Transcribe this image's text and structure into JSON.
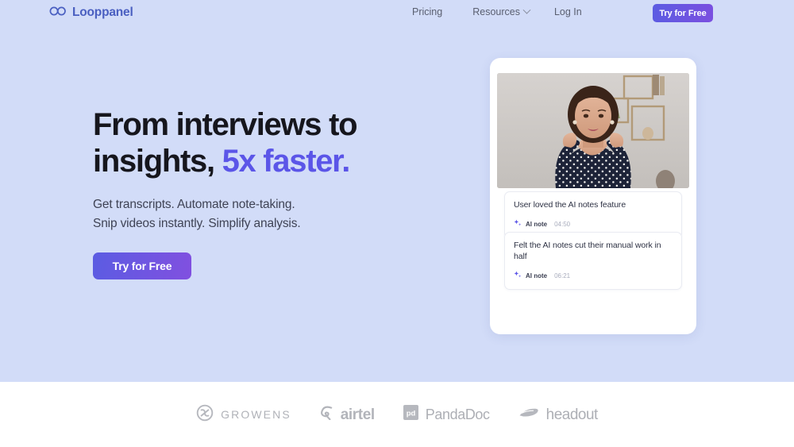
{
  "brand": {
    "name": "Looppanel",
    "mark_icon": "infinity-loop-icon",
    "color": "#4a5fc1"
  },
  "nav": {
    "links": [
      {
        "label": "Pricing",
        "name": "pricing"
      },
      {
        "label": "Resources",
        "name": "resources",
        "has_dropdown": true
      },
      {
        "label": "Log In",
        "name": "login"
      }
    ],
    "cta_label": "Try for Free",
    "cta_color": "#5b5ce2"
  },
  "hero": {
    "headline_line1": "From interviews to",
    "headline_line2_plain": "insights, ",
    "headline_line2_accent": "5x faster.",
    "accent_color": "#5b55e8",
    "subhead_line1": "Get transcripts. Automate note-taking.",
    "subhead_line2": "Snip videos instantly. Simplify analysis.",
    "cta_label": "Try for Free",
    "background_color": "#d2dcf8"
  },
  "visual": {
    "video_alt": "woman-in-polka-dot-blouse-video-thumbnail",
    "notes": [
      {
        "text": "User loved the AI notes feature",
        "tag": "AI note",
        "time": "04:50",
        "icon": "sparkle-icon"
      },
      {
        "text": "Felt the AI notes cut their manual work in half",
        "tag": "AI note",
        "time": "06:21",
        "icon": "sparkle-icon"
      }
    ]
  },
  "logos": [
    {
      "name": "growens",
      "label": "GROWENS",
      "mark": "growens-loop-mark"
    },
    {
      "name": "airtel",
      "label": "airtel",
      "mark": "airtel-swirl-mark"
    },
    {
      "name": "pandadoc",
      "label": "PandaDoc",
      "mark": "pandadoc-square-mark"
    },
    {
      "name": "headout",
      "label": "headout",
      "mark": "headout-wing-mark"
    }
  ]
}
